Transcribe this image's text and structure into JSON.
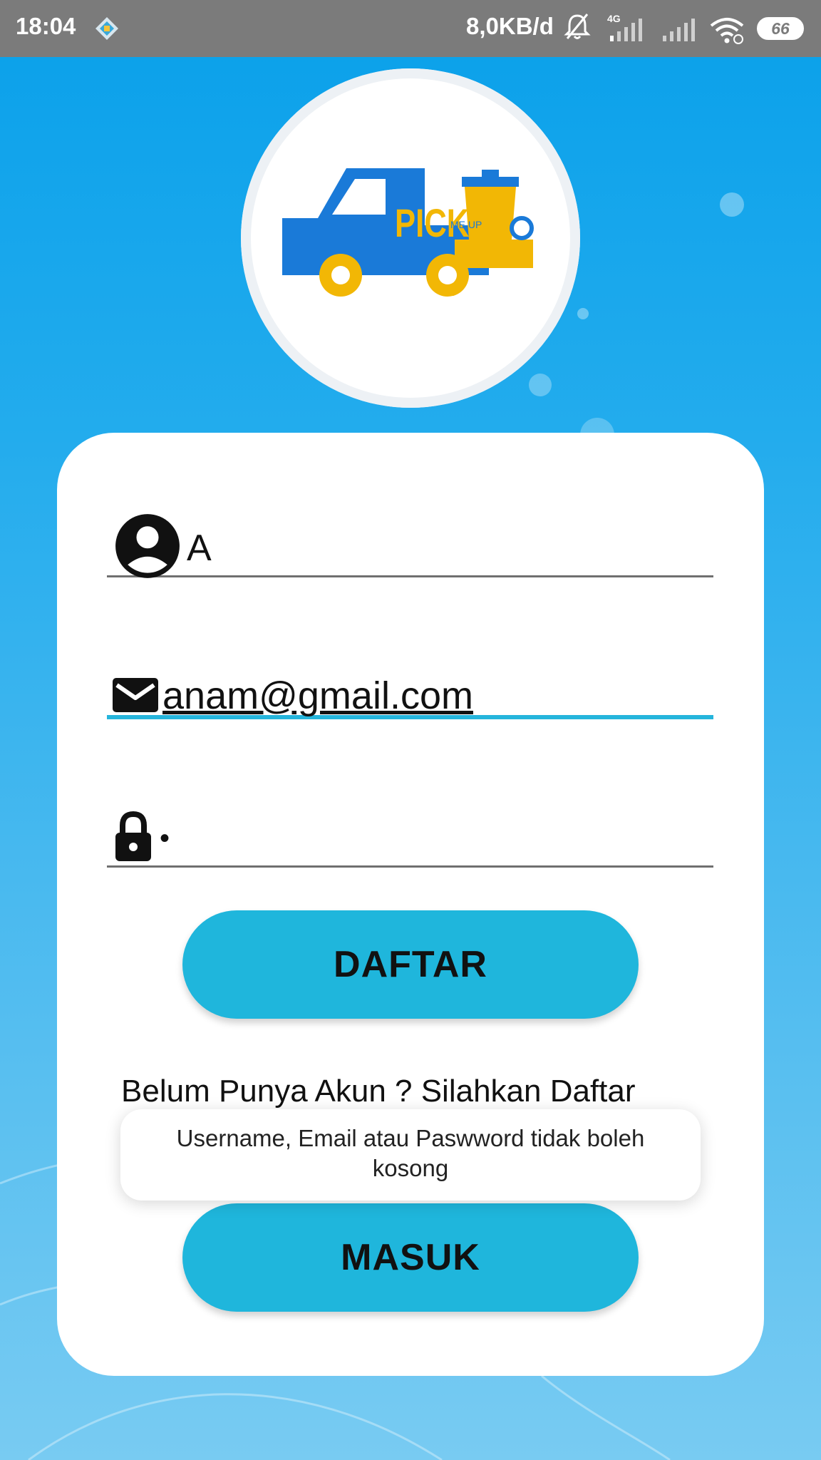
{
  "status_bar": {
    "time": "18:04",
    "network_speed": "8,0KB/d",
    "network_type": "4G",
    "battery": "66"
  },
  "logo": {
    "text_pick": "PICK",
    "text_me_up": "ME UP"
  },
  "form": {
    "username_value": "A",
    "email_value": "anam@gmail.com",
    "password_value": "•"
  },
  "buttons": {
    "register_label": "DAFTAR",
    "login_label": "MASUK"
  },
  "hint_text": "Belum Punya Akun ? Silahkan Daftar",
  "toast_message": "Username, Email atau Paswword tidak boleh kosong",
  "colors": {
    "accent": "#1fb6dc",
    "background_top": "#09a0ea",
    "background_bottom": "#78cbf2",
    "logo_blue": "#1a7ad8",
    "logo_yellow": "#f2b705"
  }
}
